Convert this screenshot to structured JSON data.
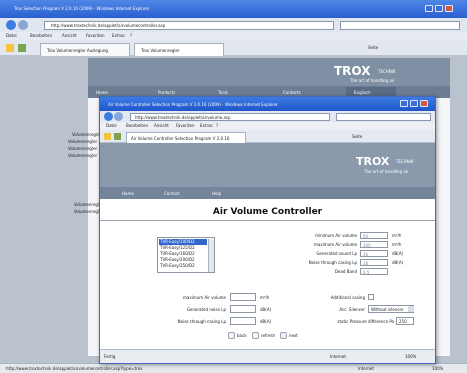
{
  "back_window": {
    "title": "Trox Selection Program V 2.0.16 (2009) - Windows Internet Explorer",
    "address": "http://www.troxtechnik.de/applet/airvolumecontroller.asp",
    "menu": [
      "Datei",
      "Bearbeiten",
      "Ansicht",
      "Favoriten",
      "Extras",
      "?"
    ],
    "tab_label": "Trox Volumenregler Auslegung",
    "tab_label_2": "Trox Volumenregler",
    "tools_label": "Seite",
    "logo": "TROX",
    "logo_sub": "TECHNIK",
    "logo_tag": "The art of handling air",
    "nav": [
      "Home",
      "Products",
      "Tools",
      "Contacts",
      "Englisch"
    ],
    "tree_items": [
      "Volumenregler",
      "Volumenregler",
      "Volumenregler",
      "Volumenregler",
      "Volumenregler",
      "Volumenregler"
    ],
    "status_left": "http://www.troxtechnik.de/applet/airvolumecontroller.asp?type=trox",
    "status_mid": "Internet",
    "status_right": "100%"
  },
  "front_window": {
    "title": "Air Volume Controller Selection Program V 2.0.16 (2009) - Windows Internet Explorer",
    "address": "http://www.troxtechnik.de/applet/airvolume.asp",
    "menu": [
      "Datei",
      "Bearbeiten",
      "Ansicht",
      "Favoriten",
      "Extras",
      "?"
    ],
    "tab_label": "Air Volume Controller Selection Program V 2.0.16",
    "tools_label": "Seite",
    "logo": "TROX",
    "logo_sub": "TECHNIK",
    "logo_tag": "The art of handling air",
    "nav": [
      "Home",
      "Contact",
      "Help"
    ],
    "page_title": "Air Volume Controller",
    "list_items": [
      "TVR-Easy/100/D2",
      "TVR-Easy/125/D2",
      "TVR-Easy/160/D2",
      "TVR-Easy/200/D2",
      "TVR-Easy/250/D2"
    ],
    "fields_right": [
      {
        "label": "minimum Air volume",
        "value": "50",
        "unit": "m³/h"
      },
      {
        "label": "maximum Air volume",
        "value": "200",
        "unit": "m³/h"
      },
      {
        "label": "Generated sound Lp",
        "value": "26",
        "unit": "dB(A)"
      },
      {
        "label": "Noise through casing Lp",
        "value": "18",
        "unit": "dB(A)"
      },
      {
        "label": "Dead Band",
        "value": "0.5",
        "unit": ""
      }
    ],
    "form": {
      "max_air_label": "maximum Air volume",
      "max_air_unit": "m³/h",
      "gen_noise_label": "Generated noise Lp",
      "gen_noise_unit": "dB(A)",
      "casing_noise_label": "Noise through casing Lp",
      "casing_noise_unit": "dB(A)",
      "add_casing_label": "Additional casing",
      "acc_silencer_label": "Acc. Silencer",
      "acc_silencer_value": "Without silencer",
      "static_pressure_label": "static Pressure difference Pa",
      "static_pressure_value": "250"
    },
    "buttons": [
      "back",
      "refresh",
      "next"
    ],
    "status_left": "Fertig",
    "status_mid": "Internet",
    "status_right": "100%"
  }
}
